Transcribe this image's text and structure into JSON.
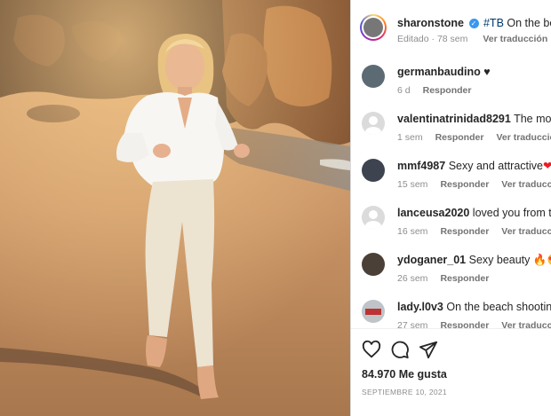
{
  "post": {
    "author": "sharonstone",
    "caption_hashtag": "#TB",
    "caption_text": "On the beach s",
    "meta": {
      "edited": "Editado · 78 sem",
      "translate": "Ver traducción"
    }
  },
  "comments": [
    {
      "user": "germanbaudino",
      "text": "♥",
      "time": "6 d",
      "reply": "Responder",
      "translate": ""
    },
    {
      "user": "valentinatrinidad8291",
      "text": "The most be",
      "time": "1 sem",
      "reply": "Responder",
      "translate": "Ver traducción"
    },
    {
      "user": "mmf4987",
      "text": "Sexy and attractive",
      "emoji": "❤❤",
      "time": "15 sem",
      "reply": "Responder",
      "translate": "Ver traducción"
    },
    {
      "user": "lanceusa2020",
      "text": "loved you from that",
      "time": "16 sem",
      "reply": "Responder",
      "translate": "Ver traducción"
    },
    {
      "user": "ydoganer_01",
      "text": "Sexy beauty",
      "emoji": "🔥😍",
      "time": "26 sem",
      "reply": "Responder",
      "translate": ""
    },
    {
      "user": "lady.l0v3",
      "text": "On the beach shooting th",
      "time": "27 sem",
      "reply": "Responder",
      "translate": "Ver traducción"
    }
  ],
  "actions": {
    "like_icon": "heart-outline-icon",
    "comment_icon": "speech-bubble-icon",
    "share_icon": "paper-plane-icon"
  },
  "likes": "84.970 Me gusta",
  "date": "SEPTIEMBRE 10, 2021"
}
